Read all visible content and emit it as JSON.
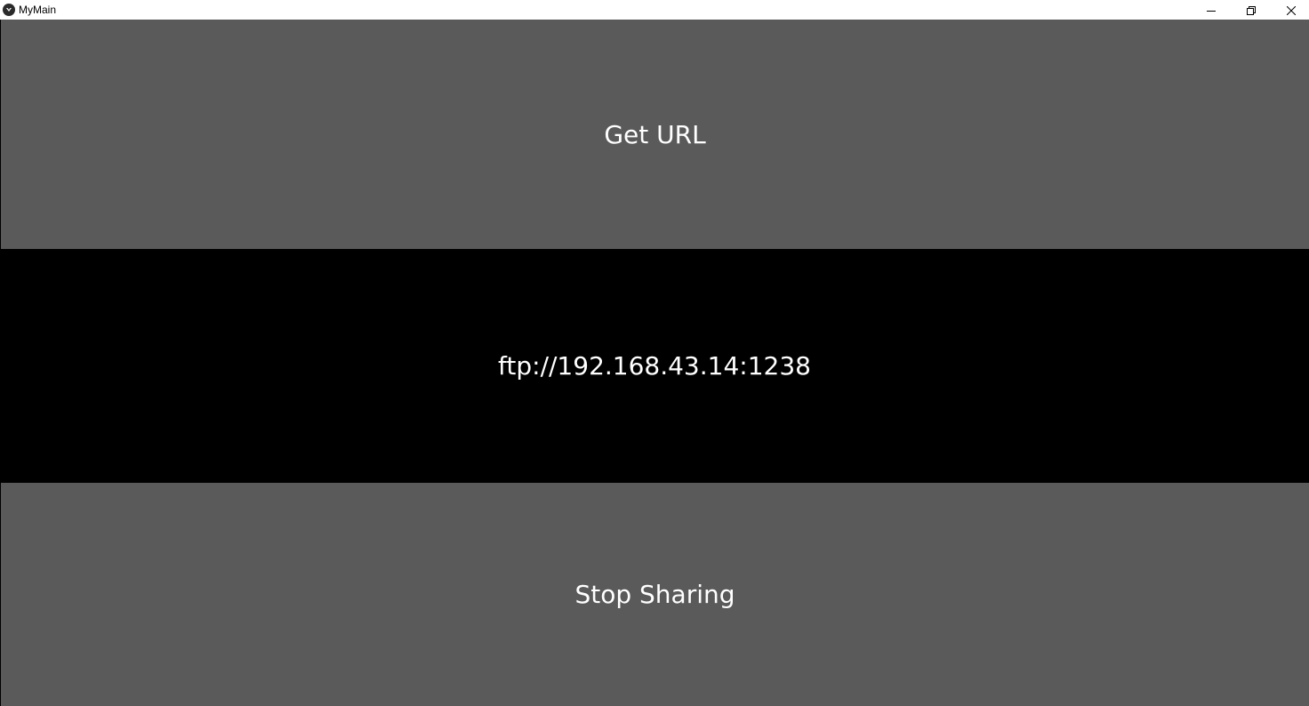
{
  "window": {
    "title": "MyMain",
    "icon": "kivy-logo-icon",
    "controls": {
      "minimize_icon": "minimize-icon",
      "maximize_icon": "restore-icon",
      "close_icon": "close-icon"
    }
  },
  "main": {
    "get_url_label": "Get URL",
    "url_text": "ftp://192.168.43.14:1238",
    "stop_sharing_label": "Stop Sharing"
  },
  "colors": {
    "button_bg": "#5a5a5a",
    "label_bg": "#000000",
    "text": "#ffffff",
    "titlebar_bg": "#ffffff"
  }
}
